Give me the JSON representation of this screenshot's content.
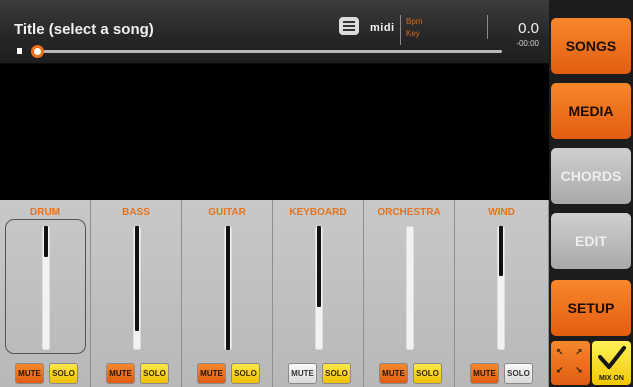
{
  "topbar": {
    "title": "Title (select a song)",
    "midi": "midi",
    "bpm_label": "Bpm",
    "key_label": "Key",
    "time": "0.0",
    "remaining": "-00:00"
  },
  "colors": {
    "accent": "#e8661a",
    "solo": "#f5d21c",
    "panel": "#bfbfbf"
  },
  "mixer": {
    "channels": [
      {
        "name": "DRUM",
        "level": 0.25,
        "mute": "MUTE",
        "solo": "SOLO"
      },
      {
        "name": "BASS",
        "level": 0.85,
        "mute": "MUTE",
        "solo": "SOLO"
      },
      {
        "name": "GUITAR",
        "level": 1.0,
        "mute": "MUTE",
        "solo": "SOLO"
      },
      {
        "name": "KEYBOARD",
        "level": 0.65,
        "mute": "MUTE",
        "solo": "SOLO"
      },
      {
        "name": "ORCHESTRA",
        "level": 0.0,
        "mute": "MUTE",
        "solo": "SOLO"
      },
      {
        "name": "WIND",
        "level": 0.4,
        "mute": "MUTE",
        "solo": "SOLO"
      }
    ]
  },
  "sidebar": {
    "songs": "SONGS",
    "media": "MEDIA",
    "chords": "CHORDS",
    "edit": "EDIT",
    "setup": "SETUP",
    "mix_on": "MIX ON"
  },
  "icons": {
    "playlist": "list-icon",
    "expand": "expand-arrows-icon",
    "mix": "check-icon"
  }
}
